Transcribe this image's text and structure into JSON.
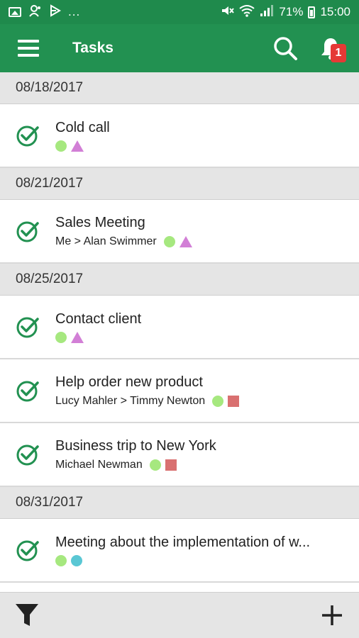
{
  "status_bar": {
    "left_icons": [
      "gallery-icon",
      "contacts-icon",
      "media-icon"
    ],
    "more": "...",
    "battery_percent": "71%",
    "time": "15:00"
  },
  "app_bar": {
    "title": "Tasks",
    "notification_count": "1"
  },
  "colors": {
    "primary": "#229151",
    "status_bar": "#1f8a4c",
    "check": "#229151",
    "green_dot": "#a6e87f",
    "purple_triangle": "#d27fd6",
    "red_square": "#d97070",
    "cyan_dot": "#5ac7d4",
    "badge": "#e53935"
  },
  "groups": [
    {
      "date": "08/18/2017",
      "tasks": [
        {
          "title": "Cold call",
          "assign": "",
          "markers": [
            "green-dot",
            "purple-triangle"
          ]
        }
      ]
    },
    {
      "date": "08/21/2017",
      "tasks": [
        {
          "title": "Sales Meeting",
          "assign": "Me > Alan Swimmer",
          "markers": [
            "green-dot",
            "purple-triangle"
          ]
        }
      ]
    },
    {
      "date": "08/25/2017",
      "tasks": [
        {
          "title": "Contact client",
          "assign": "",
          "markers": [
            "green-dot",
            "purple-triangle"
          ]
        },
        {
          "title": "Help order new product",
          "assign": "Lucy Mahler > Timmy Newton",
          "markers": [
            "green-dot",
            "red-square"
          ]
        },
        {
          "title": "Business trip to New York",
          "assign": "Michael Newman",
          "markers": [
            "green-dot",
            "red-square"
          ]
        }
      ]
    },
    {
      "date": "08/31/2017",
      "tasks": [
        {
          "title": "Meeting about the implementation of w...",
          "assign": "",
          "markers": [
            "green-dot",
            "cyan-dot"
          ]
        }
      ]
    }
  ],
  "bottom_bar": {
    "left_icon": "filter-icon",
    "right_icon": "add-icon"
  }
}
